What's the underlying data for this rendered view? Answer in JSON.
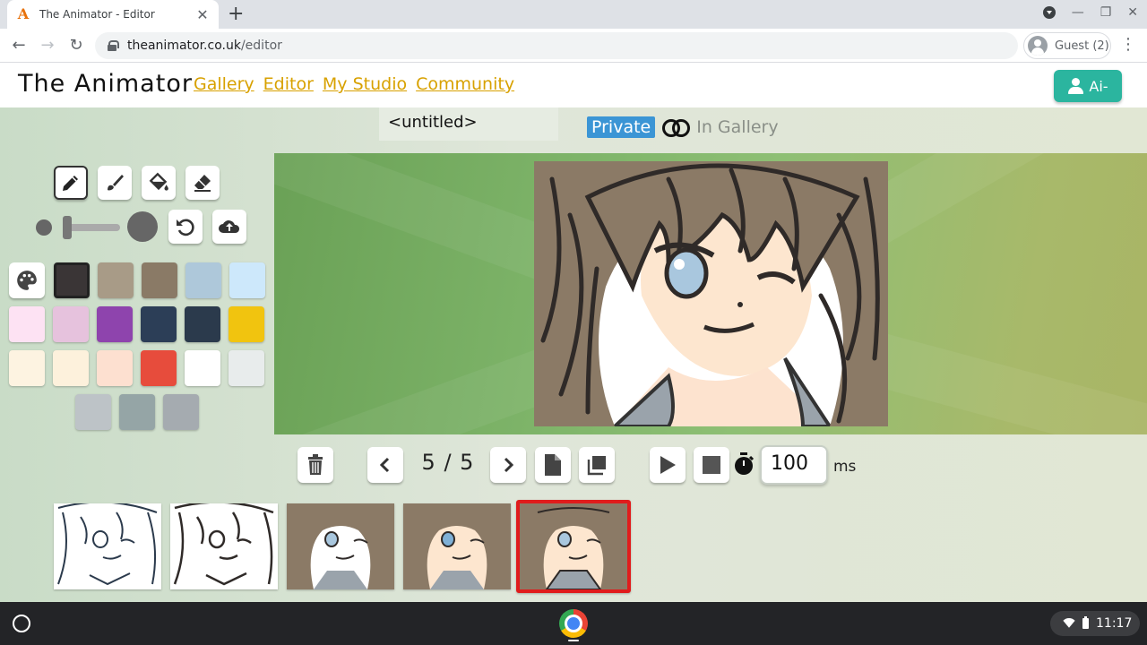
{
  "browser": {
    "tab_title": "The Animator - Editor",
    "url_host": "theanimator.co.uk",
    "url_path": "/editor",
    "profile_label": "Guest (2)"
  },
  "site": {
    "logo": "The Animator",
    "nav": [
      "Gallery",
      "Editor",
      "My Studio",
      "Community"
    ],
    "account_label": "Ai-",
    "accent_color": "#2bb59f",
    "nav_color": "#d8a100"
  },
  "editor": {
    "title": "<untitled>",
    "visibility_private": "Private",
    "visibility_gallery": "In Gallery",
    "frame_counter": "5 / 5",
    "frame_delay": "100",
    "frame_delay_unit": "ms",
    "tools": [
      "pencil-icon",
      "brush-icon",
      "fill-bucket-icon",
      "eraser-icon"
    ],
    "active_tool": "pencil",
    "palette": [
      "#3a3536",
      "#a89b87",
      "#8a7a66",
      "#aec8da",
      "#cde8fb",
      "#fde2f3",
      "#e6c2dd",
      "#8e44ad",
      "#2c3e57",
      "#2b3a4c",
      "#f1c40f",
      "#fdf3e1",
      "#fdf1dc",
      "#fde0d0",
      "#e74c3c",
      "#ffffff",
      "#e8ecec",
      "#bdc3c7",
      "#95a5a6",
      "#a5abb0"
    ],
    "selected_color": "#3a3536",
    "frames": 5,
    "current_frame": 5
  },
  "shelf": {
    "time": "11:17"
  }
}
